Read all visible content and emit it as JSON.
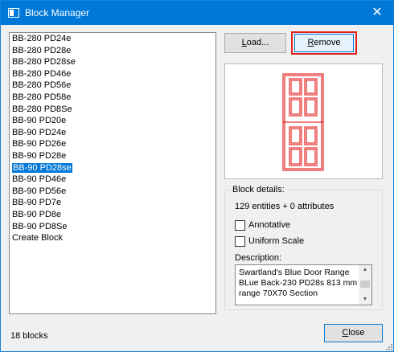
{
  "window": {
    "title": "Block Manager",
    "close_glyph": "✕"
  },
  "blocks": {
    "items": [
      "BB-280 PD24e",
      "BB-280 PD28e",
      "BB-280 PD28se",
      "BB-280 PD46e",
      "BB-280 PD56e",
      "BB-280 PD58e",
      "BB-280 PD8Se",
      "BB-90 PD20e",
      "BB-90 PD24e",
      "BB-90 PD26e",
      "BB-90 PD28e",
      "BB-90 PD28se",
      "BB-90 PD46e",
      "BB-90 PD56e",
      "BB-90 PD7e",
      "BB-90 PD8e",
      "BB-90 PD8Se",
      "Create Block"
    ],
    "selected_index": 11
  },
  "buttons": {
    "load": {
      "pre": "",
      "accel": "L",
      "post": "oad..."
    },
    "remove": {
      "pre": "",
      "accel": "R",
      "post": "emove"
    },
    "close": {
      "pre": "",
      "accel": "C",
      "post": "lose"
    }
  },
  "details": {
    "group_label": "Block details:",
    "entities": "129 entities + 0 attributes",
    "annotative": {
      "label": "Annotative",
      "checked": false
    },
    "uniform_scale": {
      "label": "Uniform Scale",
      "checked": false
    },
    "description_label": "Description:",
    "description": "Swartland's Blue Door Range BLue Back-230  PD28s 813 mm range 70X70 Section"
  },
  "status": {
    "count": "18 blocks"
  },
  "colors": {
    "titlebar": "#0078d7",
    "selection": "#0078d7",
    "highlight_frame": "#e02020",
    "preview_stroke": "#e00000"
  }
}
